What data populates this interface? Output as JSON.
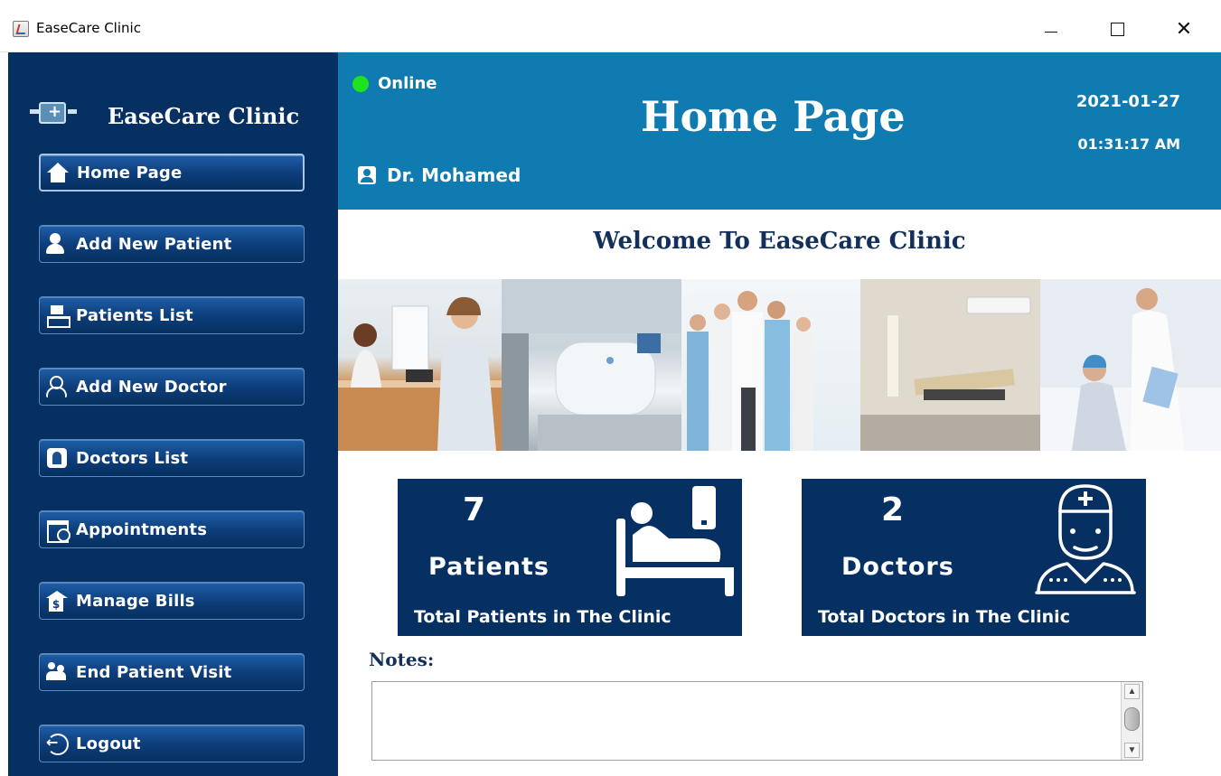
{
  "window": {
    "title": "EaseCare Clinic",
    "controls": [
      "minimize",
      "maximize",
      "close"
    ]
  },
  "sidebar": {
    "brand": "EaseCare Clinic",
    "items": [
      {
        "label": "Home Page",
        "icon": "home-icon",
        "active": true
      },
      {
        "label": "Add New Patient",
        "icon": "add-patient-icon"
      },
      {
        "label": "Patients List",
        "icon": "patients-list-icon"
      },
      {
        "label": "Add New Doctor",
        "icon": "add-doctor-icon"
      },
      {
        "label": "Doctors List",
        "icon": "doctors-list-icon"
      },
      {
        "label": "Appointments",
        "icon": "appointments-icon"
      },
      {
        "label": "Manage Bills",
        "icon": "bills-icon"
      },
      {
        "label": "End Patient Visit",
        "icon": "end-visit-icon"
      },
      {
        "label": "Logout",
        "icon": "logout-icon"
      }
    ]
  },
  "header": {
    "status": "Online",
    "status_color": "#1ee21e",
    "title": "Home Page",
    "date": "2021-01-27",
    "time": "01:31:17 AM",
    "user": "Dr. Mohamed"
  },
  "main": {
    "welcome": "Welcome To EaseCare Clinic",
    "stats": [
      {
        "count": "7",
        "kind": "Patients",
        "desc": "Total Patients in The Clinic",
        "icon": "hospital-bed-icon"
      },
      {
        "count": "2",
        "kind": "Doctors",
        "desc": "Total Doctors in The Clinic",
        "icon": "doctor-icon"
      }
    ],
    "notes_label": "Notes:",
    "notes_value": ""
  },
  "colors": {
    "sidebar": "#062f62",
    "header": "#0f7bb0",
    "card": "#062f62",
    "heading": "#13305c"
  }
}
